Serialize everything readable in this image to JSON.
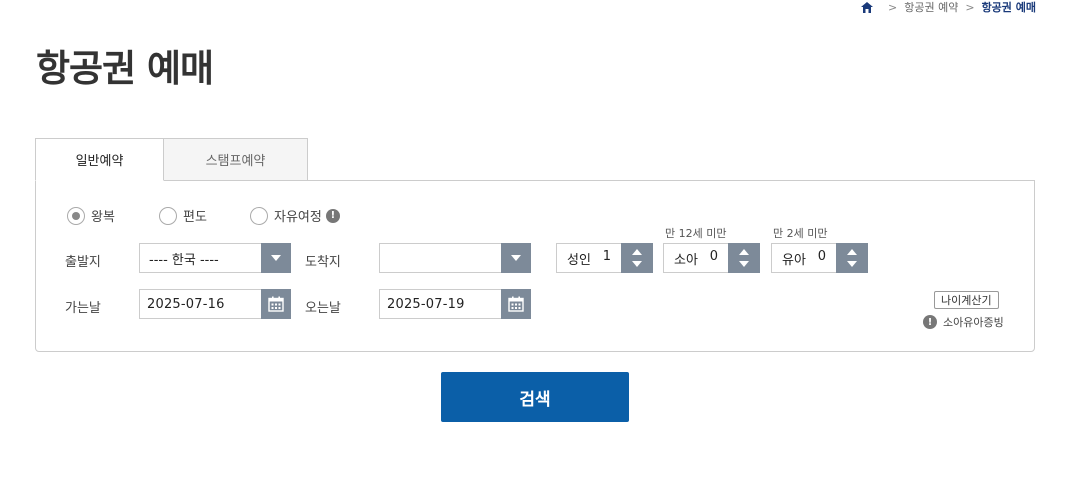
{
  "breadcrumb": {
    "items": [
      "항공권 예약",
      "항공권 예매"
    ]
  },
  "title": "항공권 예매",
  "tabs": [
    {
      "label": "일반예약",
      "active": true
    },
    {
      "label": "스탬프예약",
      "active": false
    }
  ],
  "trip_type": {
    "options": [
      "왕복",
      "편도",
      "자유여정"
    ],
    "selected": "왕복"
  },
  "fields": {
    "departure_label": "출발지",
    "departure_value": "---- 한국 ----",
    "arrival_label": "도착지",
    "arrival_value": "",
    "depart_date_label": "가는날",
    "depart_date_value": "2025-07-16",
    "return_date_label": "오는날",
    "return_date_value": "2025-07-19"
  },
  "passengers": {
    "adult": {
      "label": "성인",
      "count": "1",
      "note": ""
    },
    "child": {
      "label": "소아",
      "count": "0",
      "note": "만 12세 미만"
    },
    "infant": {
      "label": "유아",
      "count": "0",
      "note": "만 2세 미만"
    }
  },
  "age_calc_label": "나이계산기",
  "proof_label": "소아유아증빙",
  "search_label": "검색",
  "colors": {
    "accent": "#0b5fa8",
    "control": "#7d8a99",
    "breadcrumb_current": "#1a3a7a"
  }
}
